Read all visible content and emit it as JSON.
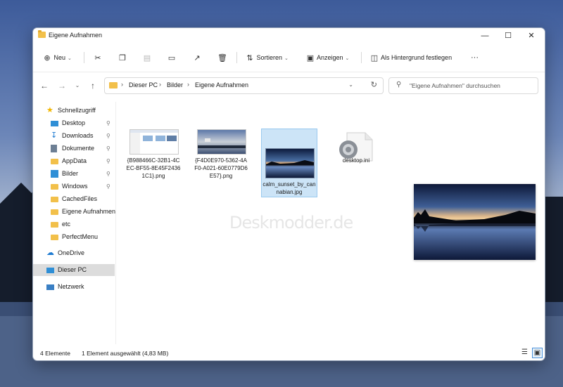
{
  "window": {
    "title": "Eigene Aufnahmen"
  },
  "toolbar": {
    "new_label": "Neu",
    "sort_label": "Sortieren",
    "view_label": "Anzeigen",
    "background_label": "Als Hintergrund festlegen",
    "more_label": "···"
  },
  "address": {
    "crumbs": [
      "Dieser PC",
      "Bilder",
      "Eigene Aufnahmen"
    ]
  },
  "search": {
    "placeholder": "\"Eigene Aufnahmen\" durchsuchen"
  },
  "sidebar": {
    "items": [
      {
        "label": "Schnellzugriff",
        "icon": "star-icon"
      },
      {
        "label": "Desktop",
        "icon": "desktop-icon",
        "pinned": true
      },
      {
        "label": "Downloads",
        "icon": "download-icon",
        "pinned": true
      },
      {
        "label": "Dokumente",
        "icon": "document-icon",
        "pinned": true
      },
      {
        "label": "AppData",
        "icon": "folder-icon",
        "pinned": true
      },
      {
        "label": "Bilder",
        "icon": "pictures-icon",
        "pinned": true
      },
      {
        "label": "Windows",
        "icon": "folder-icon",
        "pinned": true
      },
      {
        "label": "CachedFiles",
        "icon": "folder-icon"
      },
      {
        "label": "Eigene Aufnahmen",
        "icon": "folder-icon"
      },
      {
        "label": "etc",
        "icon": "folder-icon"
      },
      {
        "label": "PerfectMenu",
        "icon": "folder-icon"
      },
      {
        "label": "OneDrive",
        "icon": "cloud-icon"
      },
      {
        "label": "Dieser PC",
        "icon": "computer-icon",
        "selected": true
      },
      {
        "label": "Netzwerk",
        "icon": "network-icon"
      }
    ]
  },
  "files": [
    {
      "name": "{B988466C-32B1-4CEC-BF55-8E45F24361C1}.png"
    },
    {
      "name": "{F4D0E970-5362-4AF0-A021-60E0779D6E57}.png"
    },
    {
      "name": "calm_sunset_by_cannabian.jpg",
      "selected": true
    },
    {
      "name": "desktop.ini"
    }
  ],
  "watermark": "Deskmodder.de",
  "status": {
    "count": "4 Elemente",
    "selection": "1 Element ausgewählt (4,83 MB)"
  },
  "colors": {
    "accent": "#0067c0",
    "selection": "#cce4f7",
    "folder": "#f2c04a"
  }
}
